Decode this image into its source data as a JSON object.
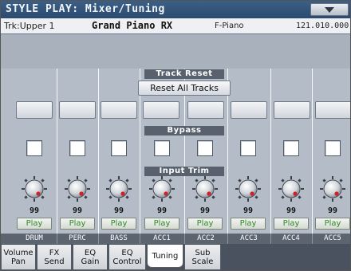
{
  "title": "STYLE PLAY: Mixer/Tuning",
  "track_info": {
    "track": "Trk:Upper 1",
    "sound": "Grand Piano RX",
    "category": "F-Piano",
    "bank": "121.010.000"
  },
  "sections": {
    "track_reset": "Track Reset",
    "reset_button": "Reset All Tracks",
    "bypass": "Bypass",
    "input_trim": "Input Trim"
  },
  "channels": [
    {
      "name": "DRUM",
      "value": "99",
      "play": "Play"
    },
    {
      "name": "PERC",
      "value": "99",
      "play": "Play"
    },
    {
      "name": "BASS",
      "value": "99",
      "play": "Play"
    },
    {
      "name": "ACC1",
      "value": "99",
      "play": "Play"
    },
    {
      "name": "ACC2",
      "value": "99",
      "play": "Play"
    },
    {
      "name": "ACC3",
      "value": "99",
      "play": "Play"
    },
    {
      "name": "ACC4",
      "value": "99",
      "play": "Play"
    },
    {
      "name": "ACC5",
      "value": "99",
      "play": "Play"
    }
  ],
  "tabs": [
    {
      "l1": "Volume",
      "l2": "Pan"
    },
    {
      "l1": "FX",
      "l2": "Send"
    },
    {
      "l1": "EQ",
      "l2": "Gain"
    },
    {
      "l1": "EQ",
      "l2": "Control"
    },
    {
      "l1": "Tuning",
      "l2": ""
    },
    {
      "l1": "Sub",
      "l2": "Scale"
    }
  ],
  "active_tab": "Tuning",
  "colors": {
    "title_bar": "#2b4a6e",
    "play_text": "#2e8a28",
    "knob_marker": "#d0202a"
  },
  "icons": {
    "menu": "triangle-down-icon",
    "knob": "knob-icon"
  }
}
